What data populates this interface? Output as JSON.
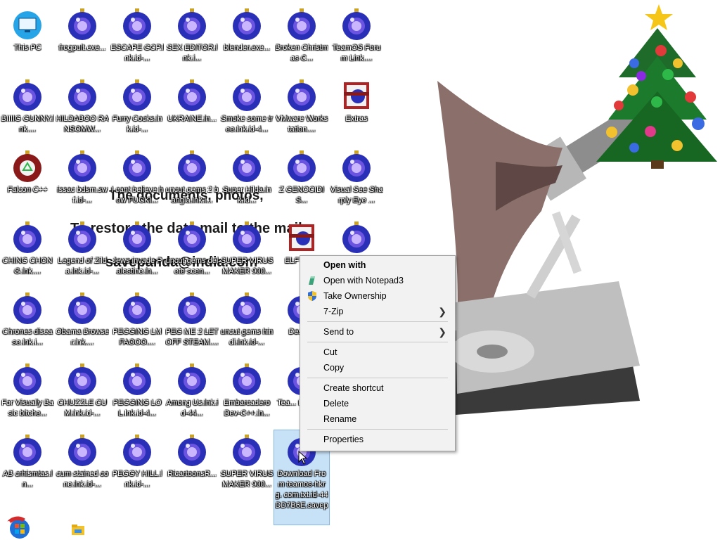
{
  "desktop": {
    "icons": [
      {
        "label": "This PC",
        "icon": "monitor-icon"
      },
      {
        "label": "frogpult.exe...",
        "icon": "ornament-icon"
      },
      {
        "label": "ESCAPE GCP.lnk.id-...",
        "icon": "ornament-icon"
      },
      {
        "label": "SEX EDITOR.lnk.i...",
        "icon": "ornament-icon"
      },
      {
        "label": "blender.exe...",
        "icon": "ornament-icon"
      },
      {
        "label": "Broken Christmas C...",
        "icon": "ornament-icon"
      },
      {
        "label": "TeamOS Forum Link....",
        "icon": "ornament-icon"
      },
      {
        "label": "BIIIIG GUNNY.lnk....",
        "icon": "ornament-icon"
      },
      {
        "label": "HILDABOO RANSOMW...",
        "icon": "ornament-icon"
      },
      {
        "label": "Furry Cocks.lnk.id-...",
        "icon": "ornament-icon"
      },
      {
        "label": "UKRAINE.ln...",
        "icon": "ornament-icon"
      },
      {
        "label": "Smoke some tree.lnk.id-4...",
        "icon": "ornament-icon"
      },
      {
        "label": "VMware Workstation....",
        "icon": "ornament-icon"
      },
      {
        "label": "Extras",
        "icon": "winrar-archive-icon"
      },
      {
        "label": "Falcon C++",
        "icon": "recycle-ornament-icon"
      },
      {
        "label": "issac bdsm.swf.id-...",
        "icon": "ornament-icon"
      },
      {
        "label": "I cant believe how FUCKI...",
        "icon": "ornament-icon"
      },
      {
        "label": "uncut gems 2 bangla.lnk.i...",
        "icon": "ornament-icon"
      },
      {
        "label": "Super Hilda.lnk.id...",
        "icon": "ornament-icon"
      },
      {
        "label": "Z GENOCIDIS...",
        "icon": "ornament-icon"
      },
      {
        "label": "Visual See Sharply Eye ...",
        "icon": "ornament-icon"
      },
      {
        "label": "CHING CHONG.lnk....",
        "icon": "ornament-icon"
      },
      {
        "label": "Legend of Zilda.lnk.id-...",
        "icon": "ornament-icon"
      },
      {
        "label": "Jews invade Palestine.ln...",
        "icon": "ornament-icon"
      },
      {
        "label": "uncut gems delete scen...",
        "icon": "ornament-icon"
      },
      {
        "label": "SUPER VIRUS MAKER 900...",
        "icon": "ornament-icon"
      },
      {
        "label": "ELF BO...",
        "icon": "winrar-archive-icon"
      },
      {
        "label": "",
        "icon": "ornament-icon"
      },
      {
        "label": "Chrones disease.lnk.i...",
        "icon": "ornament-icon"
      },
      {
        "label": "Obama Browser.lnk....",
        "icon": "ornament-icon"
      },
      {
        "label": "PEGGING LMFAOOO....",
        "icon": "ornament-icon"
      },
      {
        "label": "PEG ME 2 LET OFF STEAM....",
        "icon": "ornament-icon"
      },
      {
        "label": "uncut gems hindi.lnk.id-...",
        "icon": "ornament-icon"
      },
      {
        "label": "Deskt...",
        "icon": "ornament-icon"
      },
      {
        "label": "For Visually Basic bitche...",
        "icon": "ornament-icon"
      },
      {
        "label": "CHUZZLE CUM.lnk.id-...",
        "icon": "ornament-icon"
      },
      {
        "label": "PEGGING LOL.lnk.id-4...",
        "icon": "ornament-icon"
      },
      {
        "label": "Among Us.lnk.id-44...",
        "icon": "ornament-icon"
      },
      {
        "label": "Embarcadero Dev-C++.ln...",
        "icon": "ornament-icon"
      },
      {
        "label": "Tea... Faceb...",
        "icon": "ornament-icon"
      },
      {
        "label": "AB crhismtas.ln...",
        "icon": "ornament-icon"
      },
      {
        "label": "cum stained cone.lnk.id-...",
        "icon": "ornament-icon"
      },
      {
        "label": "PEGGY HILL.lnk.id-...",
        "icon": "ornament-icon"
      },
      {
        "label": "RicartoonsR...",
        "icon": "ornament-icon"
      },
      {
        "label": "SUPER VIRUS MAKER 900...",
        "icon": "ornament-icon"
      },
      {
        "label": "Download From teamos-hkrg. com.txt.id-44 DD7B6E.savep",
        "icon": "ornament-icon"
      }
    ]
  },
  "wallpaper": {
    "ransom_line1": "The documents, photos,",
    "ransom_line2": "To restore the data mail to the mail:",
    "ransom_line3": "savepanda@india.com"
  },
  "context_menu": {
    "items": [
      {
        "label": "Open with",
        "bold": true
      },
      {
        "label": "Open with Notepad3",
        "icon": "notepad3-icon"
      },
      {
        "label": "Take Ownership",
        "icon": "uac-shield-icon"
      },
      {
        "label": "7-Zip",
        "submenu": true
      },
      {
        "sep": true
      },
      {
        "label": "Send to",
        "submenu": true
      },
      {
        "sep": true
      },
      {
        "label": "Cut"
      },
      {
        "label": "Copy"
      },
      {
        "sep": true
      },
      {
        "label": "Create shortcut"
      },
      {
        "label": "Delete"
      },
      {
        "label": "Rename"
      },
      {
        "sep": true
      },
      {
        "label": "Properties"
      }
    ]
  },
  "taskbar": {
    "start_icon": "start-orb-icon",
    "explorer_icon": "file-explorer-icon"
  },
  "colors": {
    "ornament_blue": "#2a2fb8",
    "ornament_glow": "#c9b6ff",
    "menu_bg": "#f2f2f2",
    "selection": "#99c9ef"
  }
}
